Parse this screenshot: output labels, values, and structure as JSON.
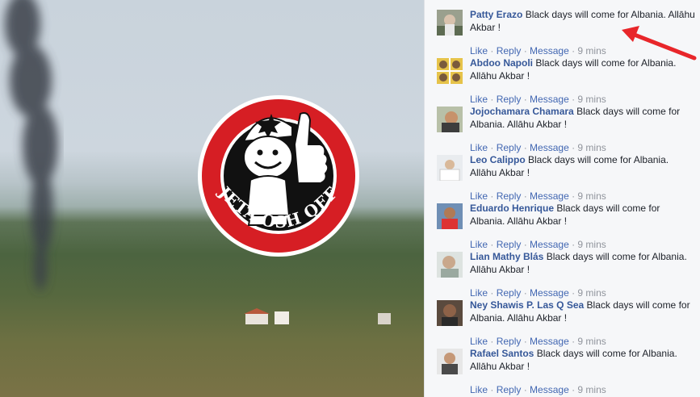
{
  "photo": {
    "logo_text": "JETA OSH QEF"
  },
  "comments": [
    {
      "author": "Patty Erazo",
      "text": "Black days will come for Albania. Allāhu Akbar !",
      "like": "Like",
      "reply": "Reply",
      "message": "Message",
      "time": "9 mins"
    },
    {
      "author": "Abdoo Napoli",
      "text": "Black days will come for Albania. Allāhu Akbar !",
      "like": "Like",
      "reply": "Reply",
      "message": "Message",
      "time": "9 mins"
    },
    {
      "author": "Jojochamara Chamara",
      "text": "Black days will come for Albania. Allāhu Akbar !",
      "like": "Like",
      "reply": "Reply",
      "message": "Message",
      "time": "9 mins"
    },
    {
      "author": "Leo Calippo",
      "text": "Black days will come for Albania. Allāhu Akbar !",
      "like": "Like",
      "reply": "Reply",
      "message": "Message",
      "time": "9 mins"
    },
    {
      "author": "Eduardo Henrique",
      "text": "Black days will come for Albania. Allāhu Akbar !",
      "like": "Like",
      "reply": "Reply",
      "message": "Message",
      "time": "9 mins"
    },
    {
      "author": "Lian Mathy Blás",
      "text": "Black days will come for Albania. Allāhu Akbar !",
      "like": "Like",
      "reply": "Reply",
      "message": "Message",
      "time": "9 mins"
    },
    {
      "author": "Ney Shawis P. Las Q Sea",
      "text": "Black days will come for Albania. Allāhu Akbar !",
      "like": "Like",
      "reply": "Reply",
      "message": "Message",
      "time": "9 mins"
    },
    {
      "author": "Rafael Santos",
      "text": "Black days will come for Albania. Allāhu Akbar !",
      "like": "Like",
      "reply": "Reply",
      "message": "Message",
      "time": "9 mins"
    }
  ],
  "colors": {
    "link": "#4267b2",
    "name": "#365899",
    "meta": "#90949c",
    "arrow": "#e8262a",
    "logo_red": "#d61e24"
  }
}
